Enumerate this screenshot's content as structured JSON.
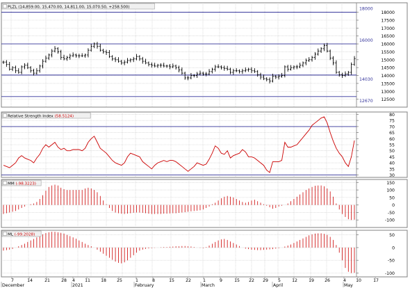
{
  "colors": {
    "price_bars": "#000000",
    "indicator": "#cc0000",
    "level_lines": "#33339a",
    "level_label": "#33339a",
    "grid": "#c8c8c8",
    "axis_text": "#000000"
  },
  "chart_data": [
    {
      "type": "ohlc",
      "panel": "price",
      "legend": "PLZL (14,859.00, 15,470.00, 14,811.00, 15,070.50, +258.500)",
      "yrange": [
        12000,
        18600
      ],
      "yticks": [
        12500,
        13000,
        13500,
        14000,
        14500,
        15000,
        15500,
        16000,
        16500,
        17000,
        17500,
        18000
      ],
      "levels": [
        {
          "value": 18000,
          "label": "18000"
        },
        {
          "value": 16000,
          "label": "16000"
        },
        {
          "value": 14030,
          "label": "14030"
        },
        {
          "value": 12670,
          "label": "12670"
        }
      ],
      "grid": true,
      "closes": [
        14850,
        14700,
        14400,
        14500,
        14300,
        14200,
        14550,
        14650,
        14500,
        14300,
        14150,
        14300,
        14600,
        14900,
        15100,
        15300,
        15550,
        15700,
        15500,
        15150,
        15050,
        15150,
        15250,
        15300,
        15250,
        15250,
        15250,
        15300,
        15600,
        15850,
        16000,
        15850,
        15600,
        15500,
        15450,
        15200,
        15050,
        15000,
        14900,
        14800,
        14850,
        14950,
        15000,
        15050,
        15200,
        15050,
        14900,
        14800,
        14700,
        14650,
        14600,
        14650,
        14650,
        14600,
        14600,
        14550,
        14600,
        14500,
        14350,
        14150,
        13850,
        13850,
        14000,
        14000,
        14100,
        14150,
        14100,
        14100,
        14250,
        14400,
        14550,
        14550,
        14500,
        14450,
        14400,
        14200,
        14300,
        14300,
        14250,
        14300,
        14350,
        14400,
        14300,
        14250,
        14050,
        13900,
        13800,
        13750,
        13650,
        13950,
        13900,
        13950,
        14000,
        14550,
        14400,
        14500,
        14550,
        14550,
        14650,
        14800,
        14950,
        15000,
        15150,
        15350,
        15550,
        15700,
        15900,
        15550,
        15100,
        14800,
        14200,
        14050,
        14000,
        14100,
        14200,
        14700,
        15070
      ]
    },
    {
      "type": "line",
      "panel": "rsi",
      "legend": "Relative Strength Index (58.5124)",
      "yrange": [
        28,
        82
      ],
      "yticks": [
        30,
        35,
        40,
        45,
        50,
        55,
        60,
        65,
        70,
        75,
        80
      ],
      "levels": [
        {
          "value": 70
        },
        {
          "value": 30
        }
      ],
      "grid": true,
      "values": [
        38,
        37,
        36,
        38,
        40,
        44,
        46,
        44,
        43,
        42,
        40,
        44,
        47,
        52,
        55,
        53,
        55,
        57,
        53,
        51,
        52,
        50,
        50,
        51,
        51,
        51,
        50,
        52,
        57,
        60,
        62,
        57,
        52,
        50,
        48,
        45,
        42,
        40,
        39,
        38,
        40,
        45,
        48,
        47,
        46,
        45,
        41,
        39,
        37,
        35,
        38,
        40,
        41,
        42,
        41,
        42,
        42,
        41,
        39,
        37,
        35,
        33,
        35,
        37,
        40,
        39,
        38,
        39,
        43,
        48,
        54,
        52,
        48,
        47,
        50,
        44,
        46,
        47,
        48,
        51,
        49,
        45,
        45,
        44,
        42,
        40,
        38,
        34,
        32,
        41,
        41,
        41,
        42,
        57,
        53,
        53,
        54,
        55,
        58,
        61,
        64,
        67,
        71,
        73,
        75,
        77,
        78,
        73,
        65,
        58,
        52,
        48,
        45,
        40,
        37,
        45,
        58.5
      ]
    },
    {
      "type": "histogram",
      "panel": "mm",
      "legend": "MM (-98.3223)",
      "yrange": [
        -150,
        170
      ],
      "yticks": [
        -100,
        -50,
        0,
        50,
        100,
        150
      ],
      "grid": true,
      "values": [
        -60,
        -55,
        -50,
        -45,
        -40,
        -30,
        -20,
        -10,
        0,
        5,
        10,
        20,
        40,
        65,
        95,
        120,
        130,
        135,
        130,
        115,
        105,
        100,
        100,
        100,
        100,
        100,
        100,
        110,
        115,
        110,
        100,
        85,
        60,
        30,
        5,
        -20,
        -40,
        -50,
        -55,
        -58,
        -60,
        -58,
        -55,
        -52,
        -50,
        -50,
        -52,
        -55,
        -58,
        -60,
        -60,
        -60,
        -60,
        -58,
        -58,
        -56,
        -55,
        -55,
        -52,
        -50,
        -48,
        -45,
        -42,
        -40,
        -38,
        -35,
        -30,
        -20,
        -10,
        5,
        15,
        30,
        45,
        55,
        60,
        55,
        50,
        40,
        30,
        20,
        15,
        20,
        30,
        35,
        25,
        15,
        5,
        -5,
        -15,
        -25,
        -20,
        -10,
        -5,
        0,
        10,
        25,
        40,
        55,
        70,
        85,
        100,
        110,
        120,
        128,
        130,
        130,
        125,
        110,
        90,
        55,
        10,
        -30,
        -60,
        -80,
        -95,
        -100,
        -98
      ]
    },
    {
      "type": "histogram",
      "panel": "ml",
      "legend": "ML (-99.2028)",
      "yrange": [
        -115,
        68
      ],
      "yticks": [
        -100,
        -50,
        0,
        50
      ],
      "grid": true,
      "values": [
        -12,
        -10,
        -8,
        -5,
        0,
        5,
        10,
        15,
        22,
        28,
        34,
        40,
        46,
        52,
        57,
        60,
        62,
        62,
        60,
        58,
        55,
        50,
        45,
        40,
        35,
        28,
        22,
        15,
        10,
        5,
        0,
        -8,
        -16,
        -24,
        -32,
        -40,
        -48,
        -55,
        -60,
        -62,
        -58,
        -50,
        -40,
        -30,
        -20,
        -12,
        -8,
        -5,
        -3,
        -2,
        -1,
        0,
        1,
        2,
        2,
        3,
        4,
        5,
        5,
        6,
        6,
        5,
        4,
        2,
        0,
        -1,
        -2,
        2,
        8,
        15,
        22,
        28,
        32,
        34,
        30,
        24,
        18,
        12,
        6,
        0,
        -4,
        -6,
        -8,
        -9,
        -10,
        -10,
        -9,
        -8,
        -7,
        -6,
        -4,
        -2,
        0,
        4,
        8,
        12,
        18,
        24,
        30,
        36,
        42,
        48,
        52,
        55,
        56,
        56,
        54,
        50,
        42,
        30,
        10,
        -20,
        -50,
        -80,
        -95,
        -100,
        -99
      ]
    }
  ],
  "x_axis": {
    "labels": [
      "7",
      "14",
      "21",
      "28",
      "4",
      "11",
      "18",
      "25",
      "1",
      "8",
      "15",
      "22",
      "1",
      "9",
      "15",
      "22",
      "29",
      "5",
      "12",
      "19",
      "26",
      "4",
      "10",
      "17"
    ],
    "months": [
      "December",
      "2021",
      "February",
      "March",
      "April",
      "May"
    ]
  }
}
